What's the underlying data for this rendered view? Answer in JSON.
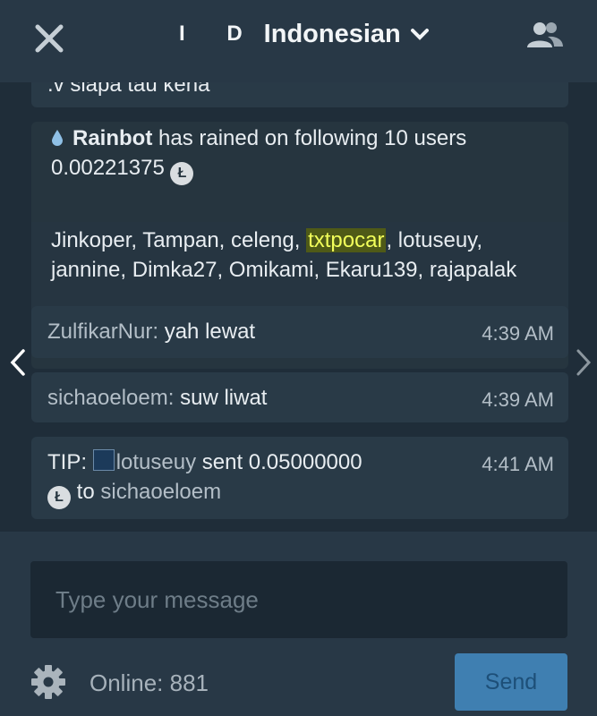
{
  "header": {
    "room_prefix": "I D",
    "room_name": "Indonesian",
    "icons": {
      "close": "close-icon",
      "dropdown": "chevron-down-icon",
      "users": "users-icon"
    }
  },
  "messages": [
    {
      "text": ".v siapa tau kena"
    },
    {
      "bot": "Rainbot",
      "action": "has rained on following 10 users",
      "amount": "0.00221375",
      "users_before": "Jinkoper, Tampan, celeng, ",
      "highlight_user": "txtpocar",
      "users_after": ", lotuseuy, jannine, Dimka27, Omikami, Ekaru139, rajapalak"
    },
    {
      "user": "ZulfikarNur:",
      "text": "yah lewat",
      "time": "4:39 AM"
    },
    {
      "user": "sichaoeloem:",
      "text": "suw liwat",
      "time": "4:39 AM"
    },
    {
      "prefix": "TIP:",
      "from": "lotuseuy",
      "sent": "sent 0.05000000",
      "to_word": "to",
      "to_user": "sichaoeloem",
      "time": "4:41 AM"
    }
  ],
  "composer": {
    "placeholder": "Type your message",
    "online_label": "Online: 881",
    "send_label": "Send"
  },
  "colors": {
    "background": "#1f2d39",
    "header": "#283846",
    "message": "#293a47",
    "highlight": "#f2ff5a",
    "send_button": "#3f7fb1"
  }
}
